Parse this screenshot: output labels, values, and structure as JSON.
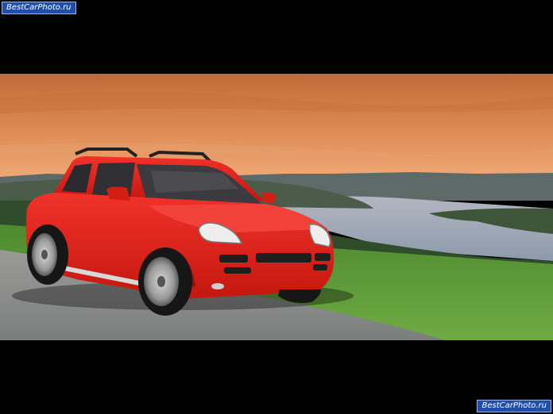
{
  "watermark": {
    "text": "BestCarPhoto.ru"
  },
  "colors": {
    "letterbox": "#000000",
    "car_body": "#e5231b",
    "sky_top": "#c9703a",
    "sky_bottom": "#efa570",
    "lake": "#9eaab8",
    "grass": "#5f9a3a",
    "road": "#8a8c8c"
  }
}
